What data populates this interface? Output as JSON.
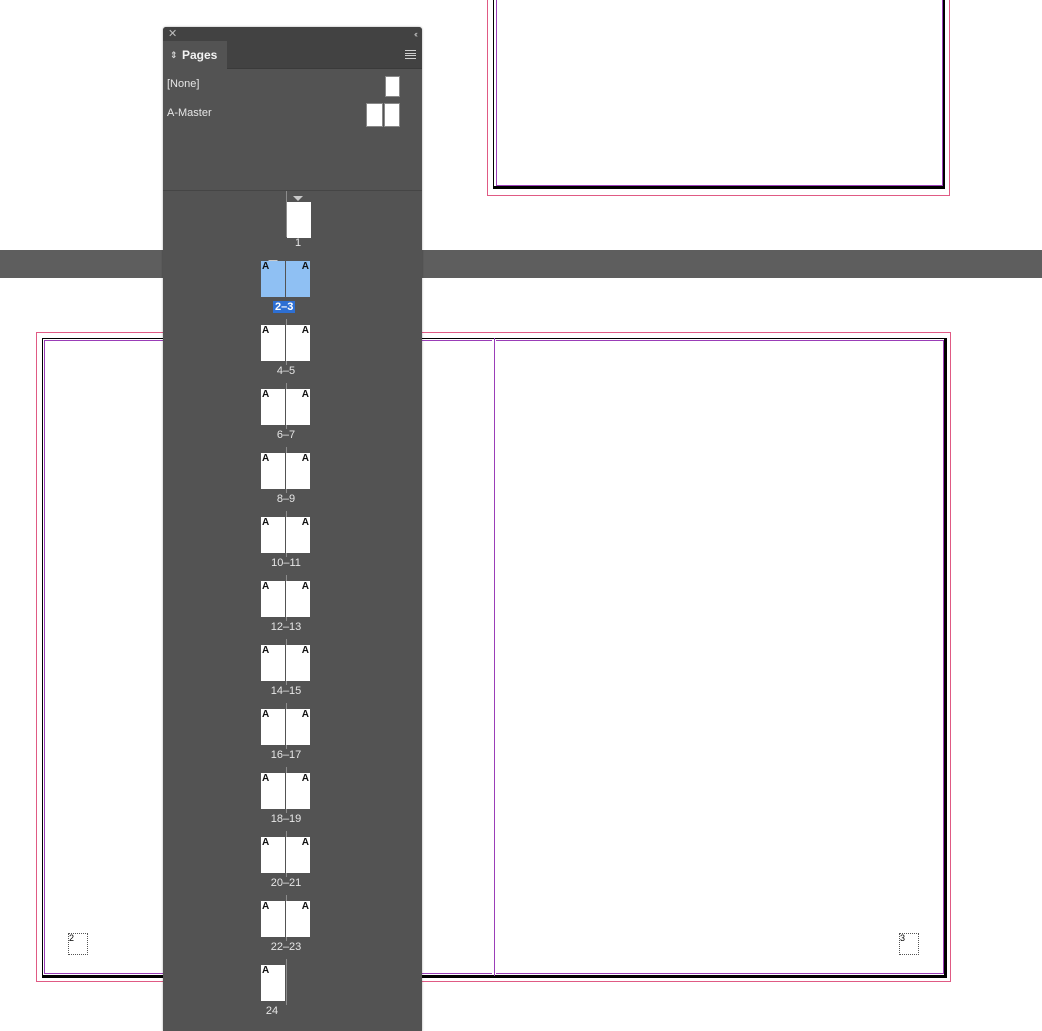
{
  "panel": {
    "tab_label": "Pages",
    "masters": [
      {
        "label": "[None]"
      },
      {
        "label": "A-Master"
      }
    ],
    "pages": [
      {
        "label": "1"
      },
      {
        "label": "2–3",
        "left_mark": "A",
        "right_mark": "A",
        "selected": true
      },
      {
        "label": "4–5",
        "left_mark": "A",
        "right_mark": "A"
      },
      {
        "label": "6–7",
        "left_mark": "A",
        "right_mark": "A"
      },
      {
        "label": "8–9",
        "left_mark": "A",
        "right_mark": "A"
      },
      {
        "label": "10–11",
        "left_mark": "A",
        "right_mark": "A"
      },
      {
        "label": "12–13",
        "left_mark": "A",
        "right_mark": "A"
      },
      {
        "label": "14–15",
        "left_mark": "A",
        "right_mark": "A"
      },
      {
        "label": "16–17",
        "left_mark": "A",
        "right_mark": "A"
      },
      {
        "label": "18–19",
        "left_mark": "A",
        "right_mark": "A"
      },
      {
        "label": "20–21",
        "left_mark": "A",
        "right_mark": "A"
      },
      {
        "label": "22–23",
        "left_mark": "A",
        "right_mark": "A"
      },
      {
        "label": "24",
        "left_mark": "A"
      }
    ]
  },
  "document": {
    "left_page_number": "2",
    "right_page_number": "3"
  },
  "colors": {
    "panel_bg": "#535353",
    "selection": "#2d6fd3",
    "selected_thumb": "#8fc0f3",
    "bleed_guide": "#e05a84",
    "margin_guide": "#9b3eb8"
  }
}
